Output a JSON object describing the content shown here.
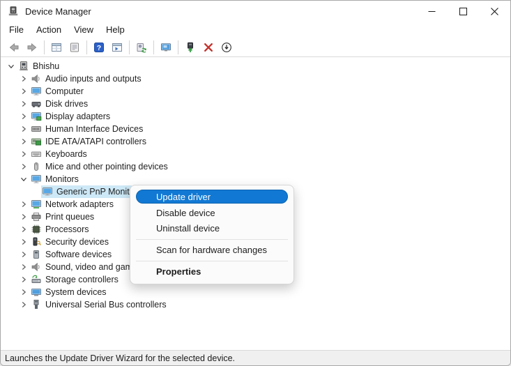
{
  "window": {
    "title": "Device Manager",
    "controls": [
      "minimize",
      "maximize",
      "close"
    ]
  },
  "menu_bar": {
    "items": [
      "File",
      "Action",
      "View",
      "Help"
    ]
  },
  "toolbar": {
    "items": [
      {
        "icon": "back-arrow-icon"
      },
      {
        "icon": "forward-arrow-icon"
      },
      {
        "separator": true
      },
      {
        "icon": "show-details-icon"
      },
      {
        "icon": "properties-page-icon"
      },
      {
        "separator": true
      },
      {
        "icon": "help-icon"
      },
      {
        "icon": "devices-by-type-icon"
      },
      {
        "separator": true
      },
      {
        "icon": "scan-hardware-icon"
      },
      {
        "separator": true
      },
      {
        "icon": "remote-computer-icon"
      },
      {
        "separator": true
      },
      {
        "icon": "update-driver-icon"
      },
      {
        "icon": "uninstall-device-icon"
      },
      {
        "icon": "disable-device-icon"
      }
    ]
  },
  "tree": {
    "items": [
      {
        "label": "Bhishu",
        "level": 0,
        "state": "expanded",
        "icon": "pc-icon",
        "selected": false
      },
      {
        "label": "Audio inputs and outputs",
        "level": 1,
        "state": "collapsed",
        "icon": "speaker-icon",
        "selected": false
      },
      {
        "label": "Computer",
        "level": 1,
        "state": "collapsed",
        "icon": "monitor-icon",
        "selected": false
      },
      {
        "label": "Disk drives",
        "level": 1,
        "state": "collapsed",
        "icon": "disk-icon",
        "selected": false
      },
      {
        "label": "Display adapters",
        "level": 1,
        "state": "collapsed",
        "icon": "display-adapter-icon",
        "selected": false
      },
      {
        "label": "Human Interface Devices",
        "level": 1,
        "state": "collapsed",
        "icon": "hid-icon",
        "selected": false
      },
      {
        "label": "IDE ATA/ATAPI controllers",
        "level": 1,
        "state": "collapsed",
        "icon": "ide-controller-icon",
        "selected": false
      },
      {
        "label": "Keyboards",
        "level": 1,
        "state": "collapsed",
        "icon": "keyboard-icon",
        "selected": false
      },
      {
        "label": "Mice and other pointing devices",
        "level": 1,
        "state": "collapsed",
        "icon": "mouse-icon",
        "selected": false
      },
      {
        "label": "Monitors",
        "level": 1,
        "state": "expanded",
        "icon": "monitor-icon",
        "selected": false
      },
      {
        "label": "Generic PnP Monit",
        "level": 2,
        "state": "none",
        "icon": "monitor-icon",
        "selected": true
      },
      {
        "label": "Network adapters",
        "level": 1,
        "state": "collapsed",
        "icon": "network-adapter-icon",
        "selected": false
      },
      {
        "label": "Print queues",
        "level": 1,
        "state": "collapsed",
        "icon": "printer-icon",
        "selected": false
      },
      {
        "label": "Processors",
        "level": 1,
        "state": "collapsed",
        "icon": "processor-icon",
        "selected": false
      },
      {
        "label": "Security devices",
        "level": 1,
        "state": "collapsed",
        "icon": "security-device-icon",
        "selected": false
      },
      {
        "label": "Software devices",
        "level": 1,
        "state": "collapsed",
        "icon": "software-device-icon",
        "selected": false
      },
      {
        "label": "Sound, video and gam",
        "level": 1,
        "state": "collapsed",
        "icon": "speaker-icon",
        "selected": false
      },
      {
        "label": "Storage controllers",
        "level": 1,
        "state": "collapsed",
        "icon": "storage-controller-icon",
        "selected": false
      },
      {
        "label": "System devices",
        "level": 1,
        "state": "collapsed",
        "icon": "system-device-icon",
        "selected": false
      },
      {
        "label": "Universal Serial Bus controllers",
        "level": 1,
        "state": "collapsed",
        "icon": "usb-icon",
        "selected": false
      }
    ]
  },
  "context_menu": {
    "items": [
      {
        "label": "Update driver",
        "highlighted": true
      },
      {
        "label": "Disable device"
      },
      {
        "label": "Uninstall device"
      },
      {
        "separator": true
      },
      {
        "label": "Scan for hardware changes"
      },
      {
        "separator": true
      },
      {
        "label": "Properties",
        "bold": true
      }
    ]
  },
  "status_bar": {
    "text": "Launches the Update Driver Wizard for the selected device."
  },
  "colors": {
    "accent": "#1179d4",
    "selection_bg": "#cde8f6"
  }
}
